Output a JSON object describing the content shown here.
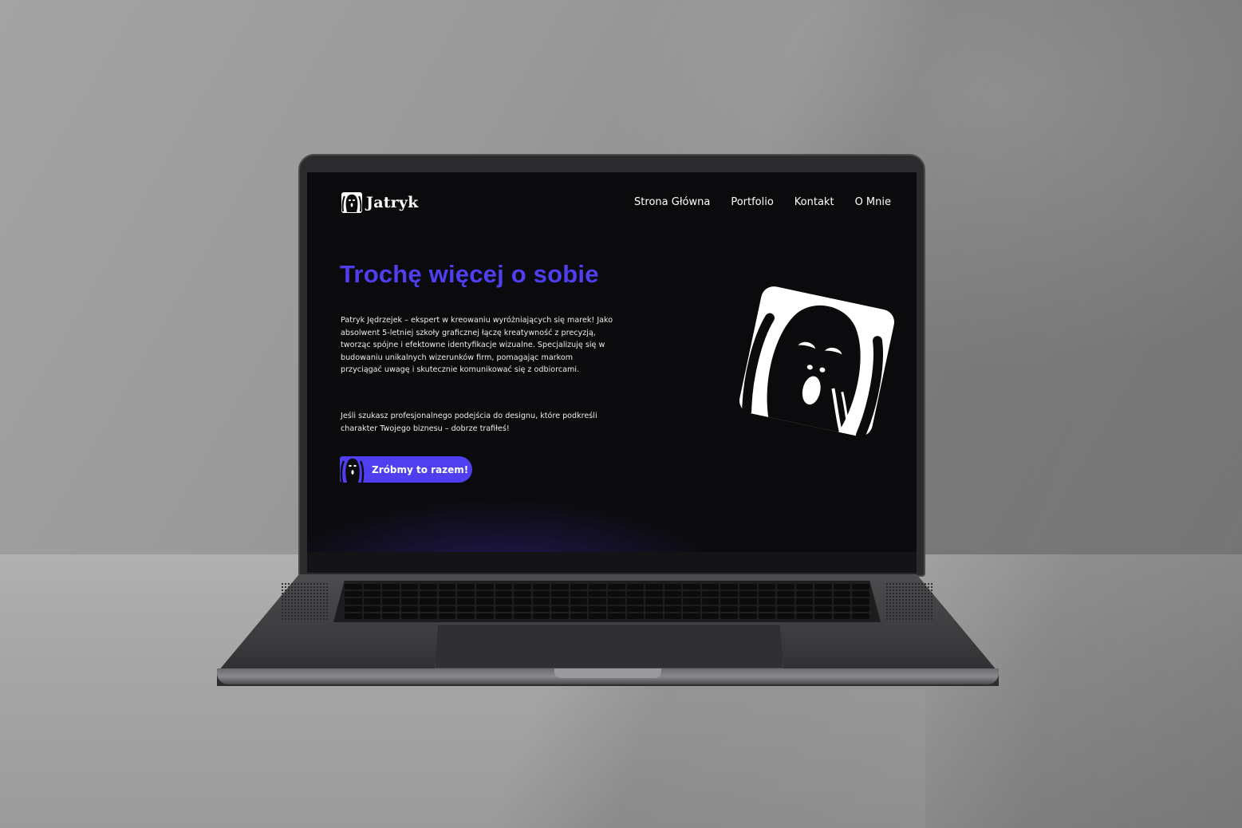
{
  "site": {
    "logo_text": "Jatryk",
    "nav": [
      {
        "label": "Strona Główna"
      },
      {
        "label": "Portfolio"
      },
      {
        "label": "Kontakt"
      },
      {
        "label": "O Mnie"
      }
    ],
    "hero": {
      "title": "Trochę więcej o sobie",
      "paragraph_1": "Patryk Jędrzejek – ekspert w kreowaniu wyróżniających się marek! Jako absolwent 5-letniej szkoły graficznej łączę kreatywność z precyzją, tworząc spójne i efektowne identyfikacje wizualne. Specjalizuję się w budowaniu unikalnych wizerunków firm, pomagając markom przyciągać uwagę i skutecznie komunikować się z odbiorcami.",
      "paragraph_2": "Jeśli szukasz profesjonalnego podejścia do designu, które podkreśli charakter Twojego biznesu – dobrze trafiłeś!",
      "cta_label": "Zróbmy to razem!"
    }
  },
  "colors": {
    "accent": "#4f3ff0",
    "screen_bg": "#0b0b0d",
    "text": "#ffffff"
  },
  "icons": {
    "logo": "scream-face-icon",
    "cta": "scream-face-icon",
    "hero_art": "scream-face-illustration"
  }
}
